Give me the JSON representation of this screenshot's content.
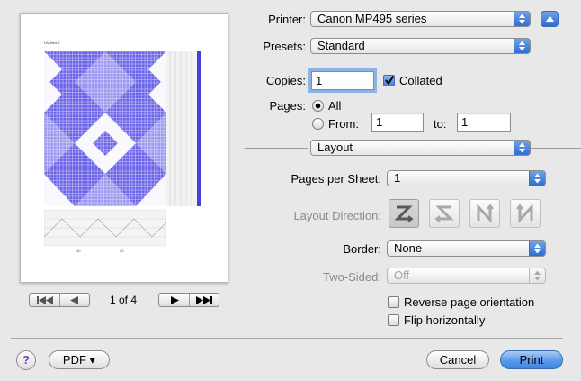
{
  "printer": {
    "label": "Printer:",
    "value": "Canon MP495 series"
  },
  "presets": {
    "label": "Presets:",
    "value": "Standard"
  },
  "copies": {
    "label": "Copies:",
    "value": "1",
    "collated_label": "Collated",
    "collated": true
  },
  "pages": {
    "label": "Pages:",
    "all_label": "All",
    "from_label": "From:",
    "from_value": "1",
    "to_label": "to:",
    "to_value": "1",
    "selected": "all"
  },
  "section": {
    "value": "Layout"
  },
  "layout": {
    "pages_per_sheet_label": "Pages per Sheet:",
    "pages_per_sheet_value": "1",
    "layout_direction_label": "Layout Direction:",
    "border_label": "Border:",
    "border_value": "None",
    "two_sided_label": "Two-Sided:",
    "two_sided_value": "Off",
    "reverse_label": "Reverse page orientation",
    "flip_label": "Flip horizontally"
  },
  "preview": {
    "page_indicator": "1 of 4",
    "page_caption": "LW-tiled 2",
    "chart_ticks": [
      "40",
      "20"
    ]
  },
  "footer": {
    "help_symbol": "?",
    "pdf_label": "PDF ▾",
    "cancel_label": "Cancel",
    "print_label": "Print"
  },
  "colors": {
    "accent": "#3c85e0",
    "pattern": "#6a63e8",
    "pattern_light": "#ffffff"
  }
}
